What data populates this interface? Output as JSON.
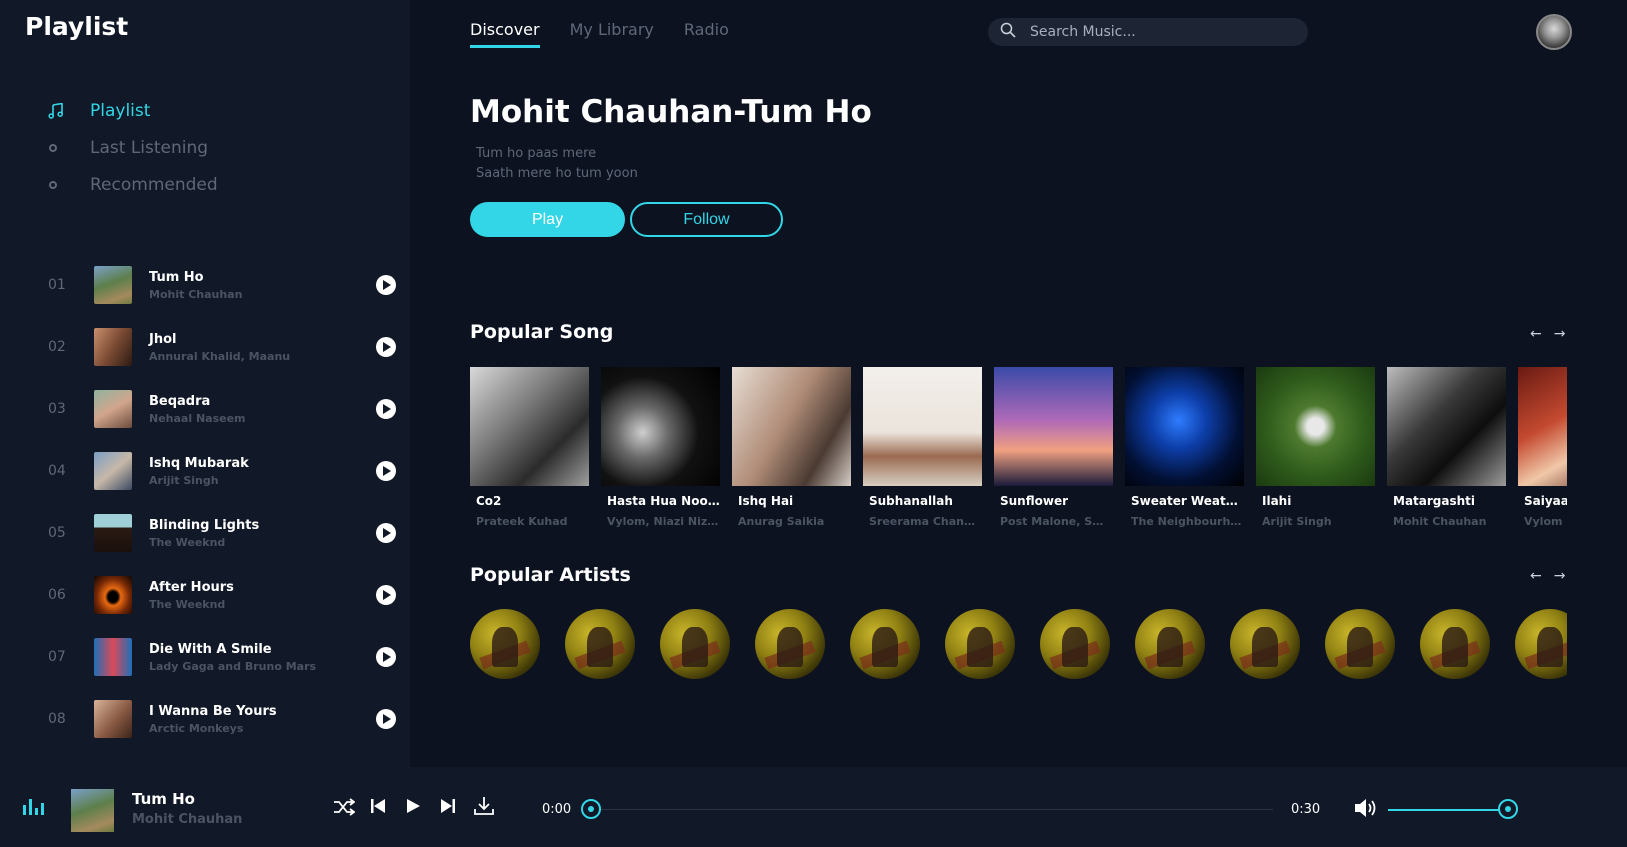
{
  "sidebar": {
    "brand": "Playlist",
    "nav": [
      {
        "label": "Playlist",
        "icon": "music-note-icon",
        "active": true
      },
      {
        "label": "Last Listening",
        "icon": "dot-icon",
        "active": false
      },
      {
        "label": "Recommended",
        "icon": "dot-icon",
        "active": false
      }
    ],
    "tracks": [
      {
        "num": "01",
        "title": "Tum Ho",
        "artist": "Mohit Chauhan"
      },
      {
        "num": "02",
        "title": "Jhol",
        "artist": "Annural Khalid, Maanu"
      },
      {
        "num": "03",
        "title": "Beqadra",
        "artist": "Nehaal Naseem"
      },
      {
        "num": "04",
        "title": "Ishq Mubarak",
        "artist": "Arijit Singh"
      },
      {
        "num": "05",
        "title": "Blinding Lights",
        "artist": "The Weeknd"
      },
      {
        "num": "06",
        "title": "After Hours",
        "artist": "The Weeknd"
      },
      {
        "num": "07",
        "title": "Die With A Smile",
        "artist": "Lady Gaga and Bruno Mars"
      },
      {
        "num": "08",
        "title": "I Wanna Be Yours",
        "artist": "Arctic Monkeys"
      }
    ]
  },
  "header": {
    "tabs": [
      {
        "label": "Discover",
        "active": true
      },
      {
        "label": "My Library",
        "active": false
      },
      {
        "label": "Radio",
        "active": false
      }
    ],
    "search_placeholder": "Search Music..."
  },
  "hero": {
    "title": "Mohit Chauhan-Tum Ho",
    "lyric_line_1": "Tum ho paas mere",
    "lyric_line_2": "Saath mere ho tum yoon",
    "play_label": "Play",
    "follow_label": "Follow"
  },
  "popular_song": {
    "title": "Popular Song",
    "songs": [
      {
        "title": "Co2",
        "artist": "Prateek Kuhad"
      },
      {
        "title": "Hasta Hua Noorani Chehra",
        "artist": "Vylom, Niazi Nizami"
      },
      {
        "title": "Ishq Hai",
        "artist": "Anurag Saikia"
      },
      {
        "title": "Subhanallah",
        "artist": "Sreerama Chandra"
      },
      {
        "title": "Sunflower",
        "artist": "Post Malone, Swae Lee"
      },
      {
        "title": "Sweater Weather",
        "artist": "The Neighbourhood"
      },
      {
        "title": "Ilahi",
        "artist": "Arijit Singh"
      },
      {
        "title": "Matargashti",
        "artist": "Mohit Chauhan"
      },
      {
        "title": "Saiyaan",
        "artist": "Vylom"
      }
    ]
  },
  "popular_artists": {
    "title": "Popular Artists",
    "count": 12
  },
  "player": {
    "title": "Tum Ho",
    "artist": "Mohit Chauhan",
    "current_time": "0:00",
    "duration": "0:30",
    "progress": 0,
    "volume": 1
  },
  "colors": {
    "accent": "#33d6e6",
    "background": "#0c1220",
    "panel": "#111827",
    "muted": "#5f6878"
  }
}
